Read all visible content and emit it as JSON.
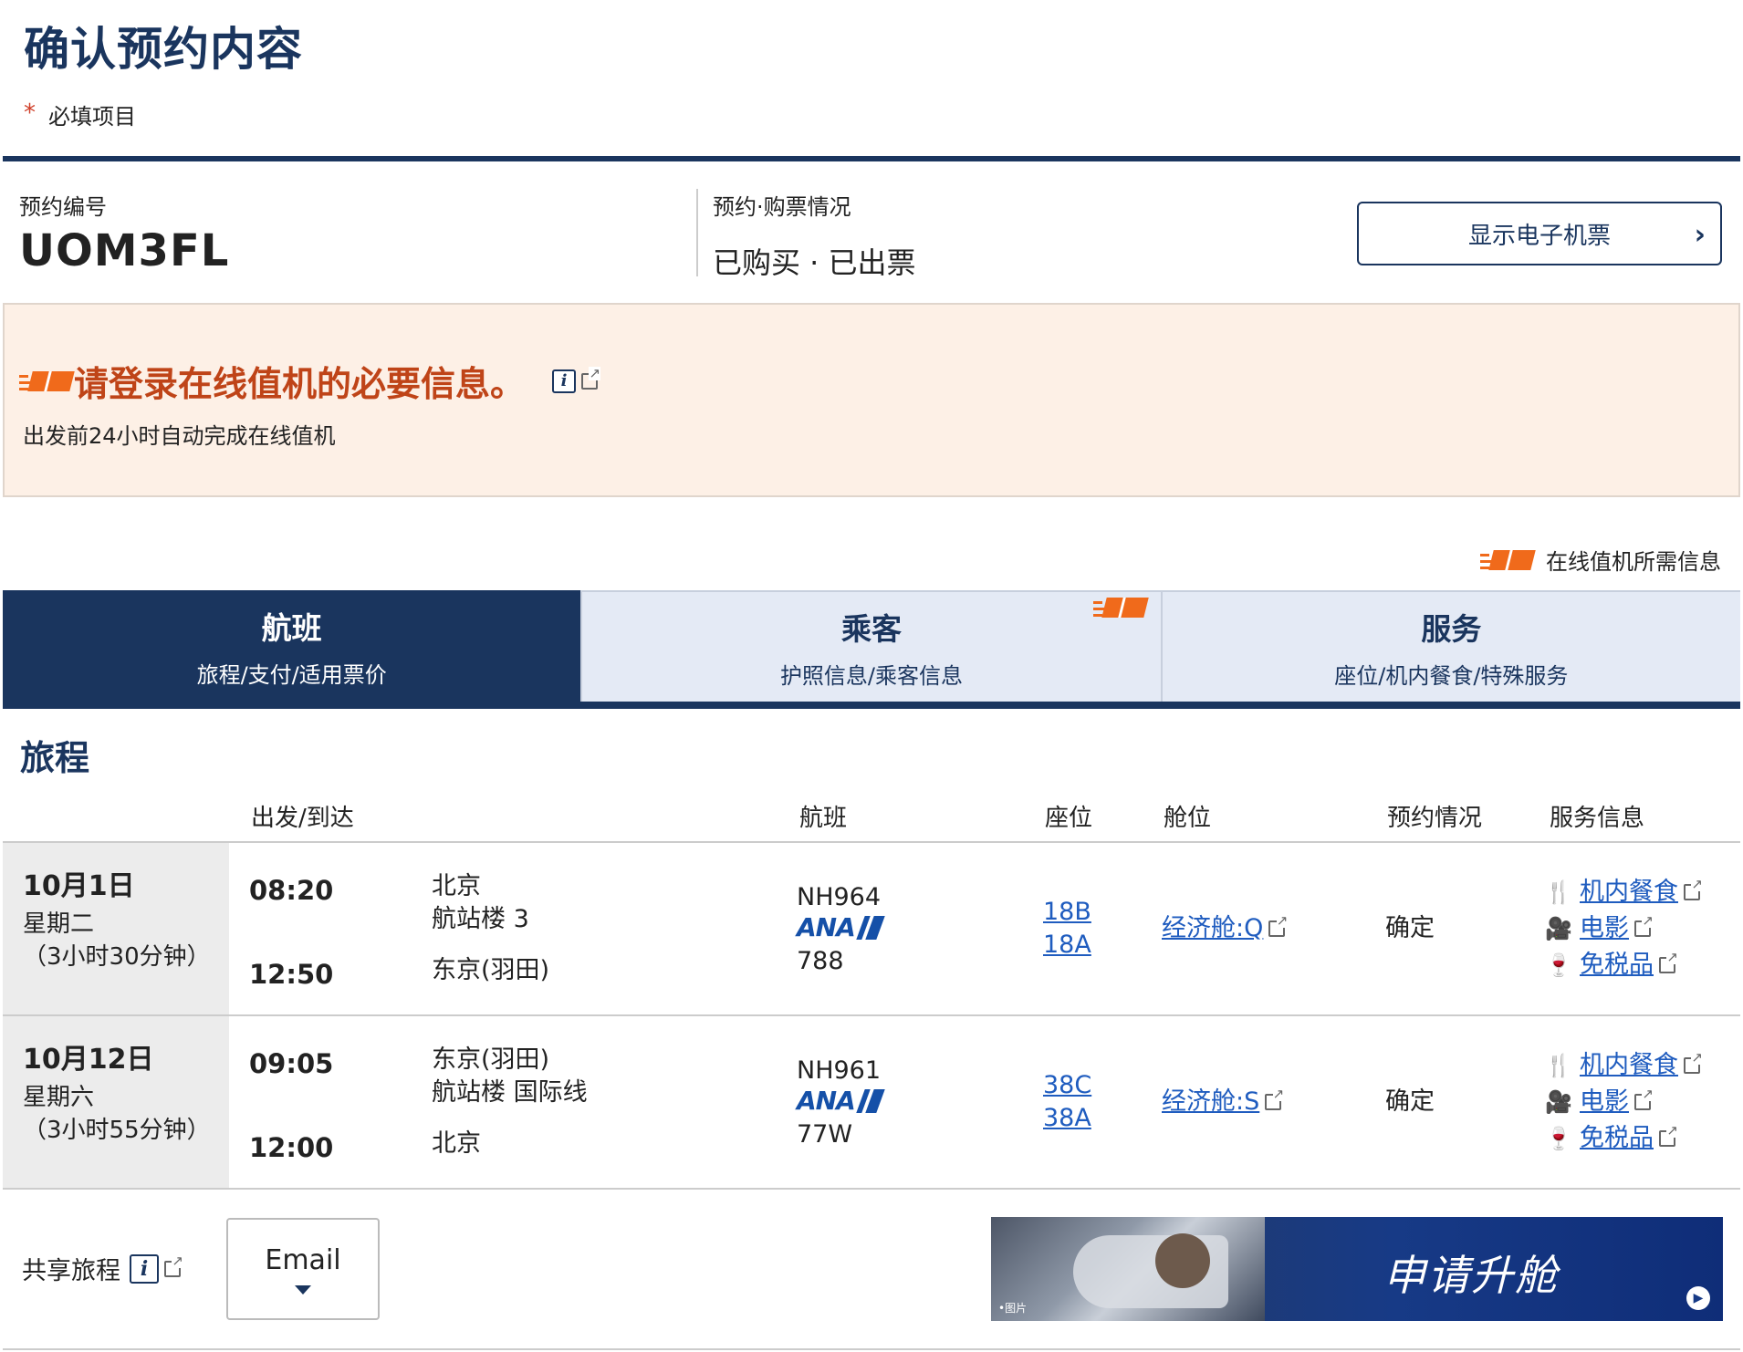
{
  "page": {
    "title": "确认预约内容",
    "required_mark": "*",
    "required_label": "必填项目"
  },
  "summary": {
    "booking_label": "预约编号",
    "booking_code": "UOM3FL",
    "status_label": "预约·购票情况",
    "status_value": "已购买 · 已出票",
    "eticket_button": "显示电子机票"
  },
  "notice": {
    "title": "请登录在线值机的必要信息。",
    "subtitle": "出发前24小时自动完成在线值机"
  },
  "legend": {
    "label": "在线值机所需信息"
  },
  "tabs": [
    {
      "title": "航班",
      "subtitle": "旅程/支付/适用票价",
      "active": true
    },
    {
      "title": "乘客",
      "subtitle": "护照信息/乘客信息",
      "active": false
    },
    {
      "title": "服务",
      "subtitle": "座位/机内餐食/特殊服务",
      "active": false
    }
  ],
  "itinerary": {
    "title": "旅程",
    "headers": {
      "route": "出发/到达",
      "flight": "航班",
      "seat": "座位",
      "cabin": "舱位",
      "status": "预约情况",
      "services": "服务信息"
    },
    "rows": [
      {
        "date": "10月1日",
        "weekday": "星期二",
        "duration": "（3小时30分钟）",
        "dep_time": "08:20",
        "dep_city": "北京",
        "dep_terminal": "航站楼 3",
        "arr_time": "12:50",
        "arr_city": "东京(羽田)",
        "flight_no": "NH964",
        "airline": "ANA",
        "aircraft": "788",
        "seat1": "18B",
        "seat2": "18A",
        "cabin": "经济舱:Q",
        "status": "确定",
        "svc_meal": "机内餐食",
        "svc_movie": "电影",
        "svc_dutyfree": "免税品"
      },
      {
        "date": "10月12日",
        "weekday": "星期六",
        "duration": "（3小时55分钟）",
        "dep_time": "09:05",
        "dep_city": "东京(羽田)",
        "dep_terminal": "航站楼 国际线",
        "arr_time": "12:00",
        "arr_city": "北京",
        "flight_no": "NH961",
        "airline": "ANA",
        "aircraft": "77W",
        "seat1": "38C",
        "seat2": "38A",
        "cabin": "经济舱:S",
        "status": "确定",
        "svc_meal": "机内餐食",
        "svc_movie": "电影",
        "svc_dutyfree": "免税品"
      }
    ]
  },
  "share": {
    "label": "共享旅程",
    "email_button": "Email"
  },
  "banner": {
    "text": "申请升舱",
    "caption": "•图片"
  },
  "colors": {
    "navy": "#1a355e",
    "accent_orange": "#f06a1b",
    "notice_bg": "#fdf0e6",
    "link_blue": "#1f5cbf"
  }
}
